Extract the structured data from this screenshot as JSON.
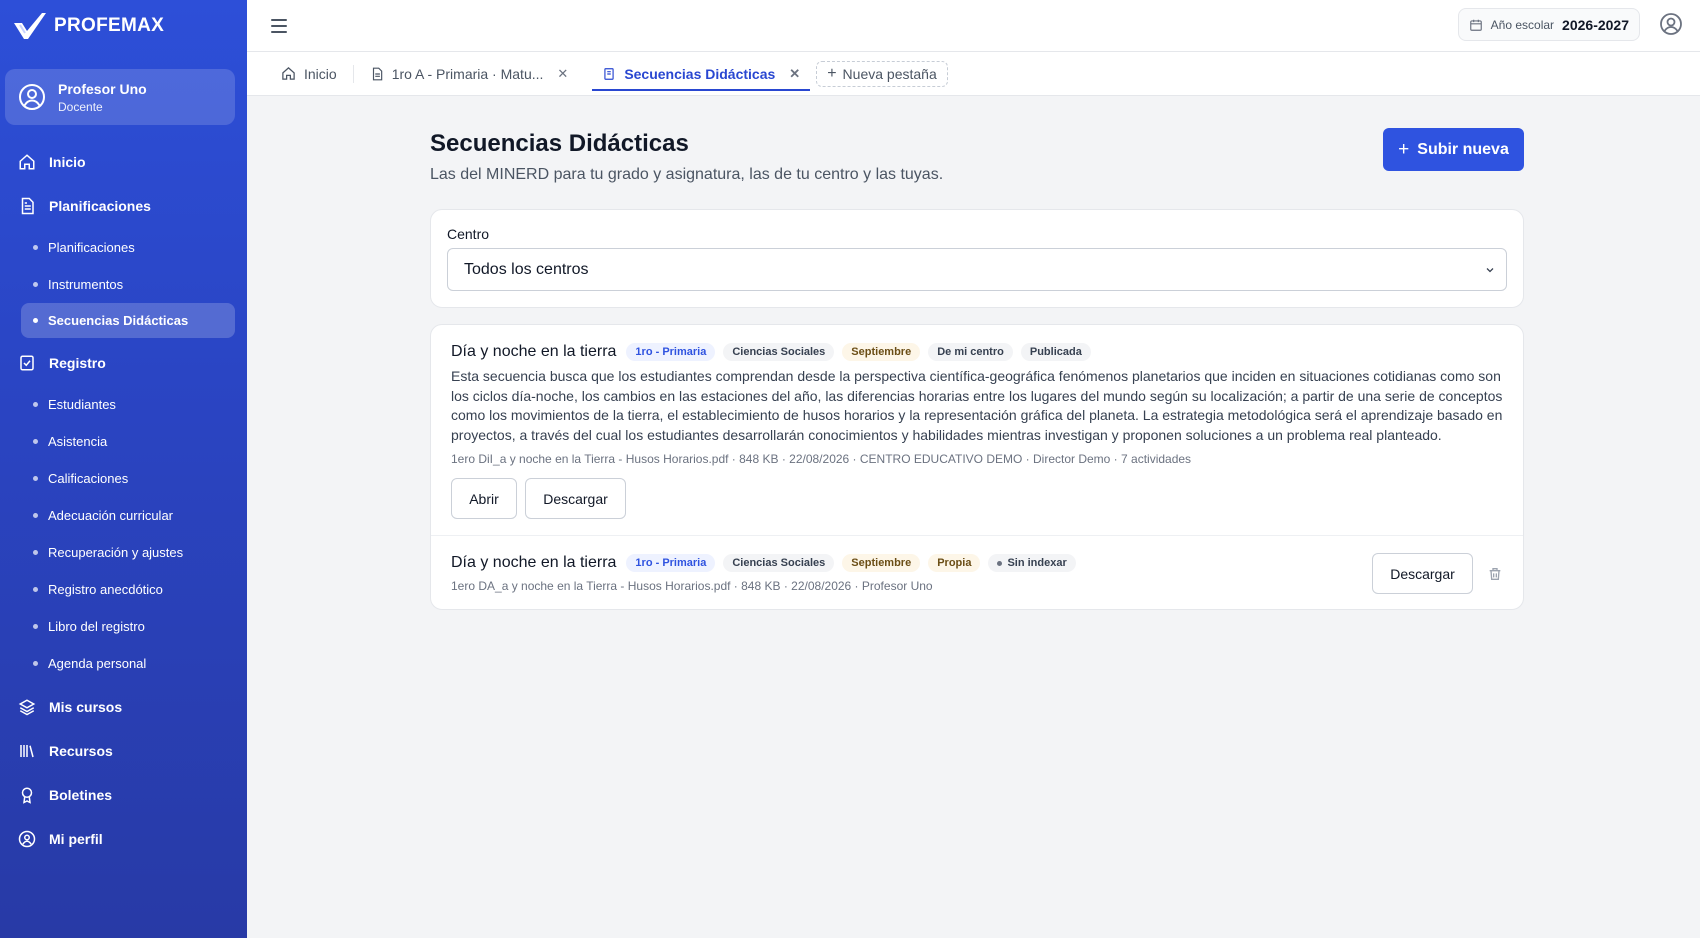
{
  "app": {
    "brand": "PROFEMAX"
  },
  "user": {
    "name": "Profesor Uno",
    "role": "Docente"
  },
  "sidebar": {
    "items": [
      {
        "label": "Inicio",
        "icon": "home-icon"
      },
      {
        "label": "Planificaciones",
        "icon": "document-icon",
        "children": [
          "Planificaciones",
          "Instrumentos",
          "Secuencias Didácticas"
        ]
      },
      {
        "label": "Registro",
        "icon": "check-square-icon",
        "children": [
          "Estudiantes",
          "Asistencia",
          "Calificaciones",
          "Adecuación curricular",
          "Recuperación y ajustes",
          "Registro anecdótico",
          "Libro del registro",
          "Agenda personal"
        ]
      },
      {
        "label": "Mis cursos",
        "icon": "layers-icon"
      },
      {
        "label": "Recursos",
        "icon": "library-icon"
      },
      {
        "label": "Boletines",
        "icon": "award-icon"
      },
      {
        "label": "Mi perfil",
        "icon": "user-circle-icon"
      }
    ],
    "active_child": "Secuencias Didácticas"
  },
  "topbar": {
    "year_label": "Año escolar",
    "year_value": "2026-2027"
  },
  "tabs": [
    {
      "label": "Inicio"
    },
    {
      "label": "1ro A - Primaria · Matu..."
    },
    {
      "label": "Secuencias Didácticas"
    }
  ],
  "new_tab_label": "Nueva pestaña",
  "page": {
    "title": "Secuencias Didácticas",
    "subtitle": "Las del MINERD para tu grado y asignatura, las de tu centro y las tuyas.",
    "upload_button": "Subir nueva"
  },
  "filter": {
    "label": "Centro",
    "value": "Todos los centros"
  },
  "items": [
    {
      "title": "Día y noche en la tierra",
      "badges": [
        "1ro - Primaria",
        "Ciencias Sociales",
        "Septiembre",
        "De mi centro",
        "Publicada"
      ],
      "description": "Esta secuencia busca que los estudiantes comprendan desde la perspectiva científica-geográfica fenómenos planetarios que inciden en situaciones cotidianas como son los ciclos día-noche, los cambios en las estaciones del año, las diferencias horarias entre los lugares del mundo según su localización; a partir de una serie de conceptos como los movimientos de la tierra, el establecimiento de husos horarios y la representación gráfica del planeta. La estrategia metodológica será el aprendizaje basado en proyectos, a través del cual los estudiantes desarrollarán conocimientos y habilidades mientras investigan y proponen soluciones a un problema real planteado.",
      "meta": "1ero DiI_a y noche en la Tierra - Husos Horarios.pdf · 848 KB · 22/08/2026 · CENTRO EDUCATIVO DEMO · Director Demo · 7 actividades",
      "open_label": "Abrir",
      "download_label": "Descargar"
    },
    {
      "title": "Día y noche en la tierra",
      "badges": [
        "1ro - Primaria",
        "Ciencias Sociales",
        "Septiembre",
        "Propia",
        "Sin indexar"
      ],
      "meta": "1ero DA_a y noche en la Tierra - Husos Horarios.pdf · 848 KB · 22/08/2026 · Profesor Uno",
      "download_label": "Descargar"
    }
  ]
}
